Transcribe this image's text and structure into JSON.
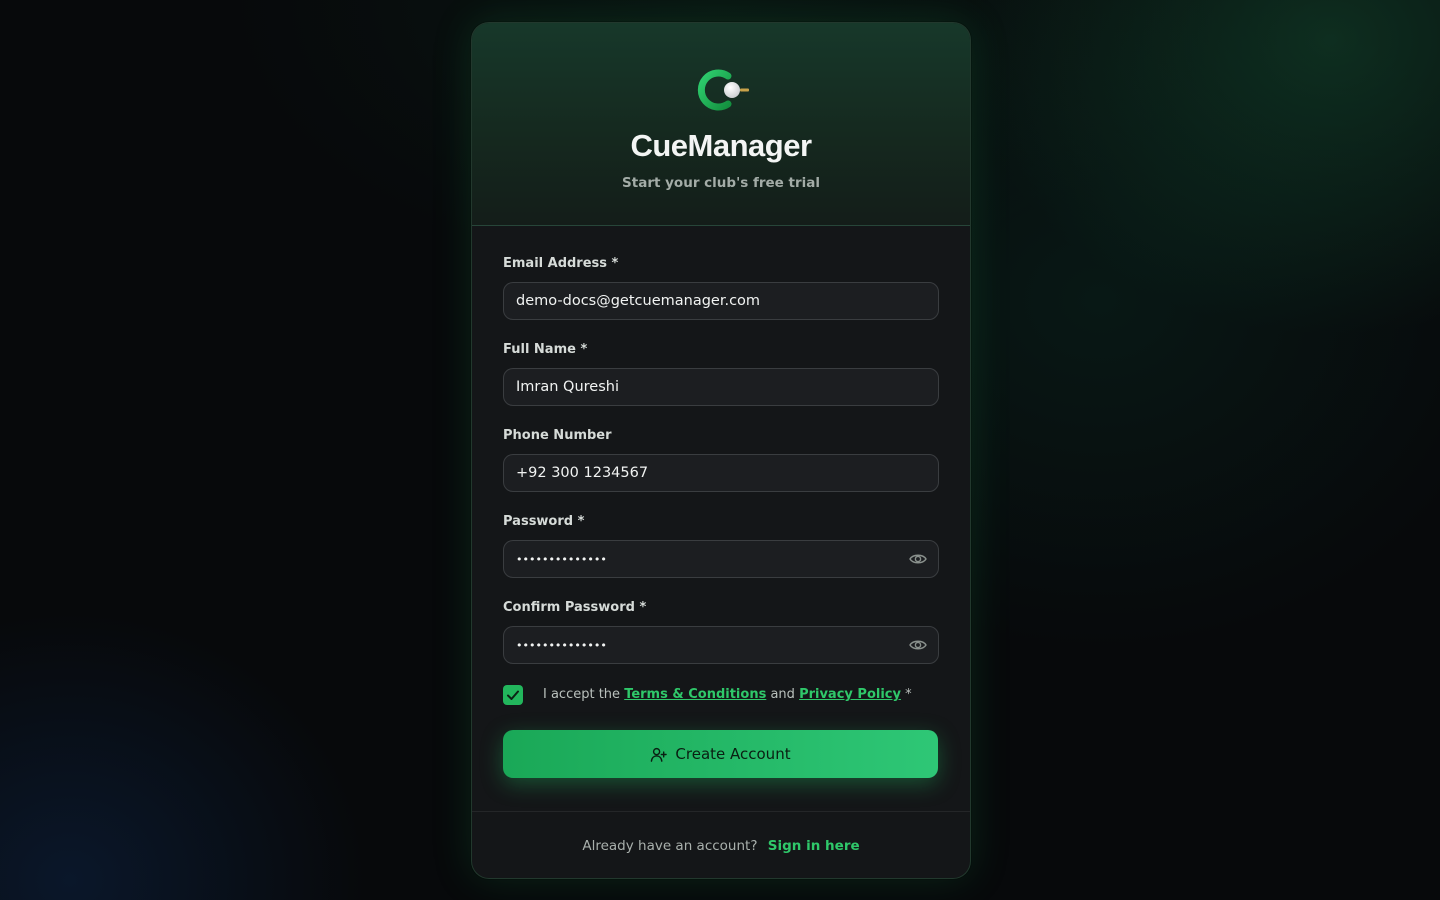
{
  "brand": {
    "name": "CueManager",
    "tagline": "Start your club's free trial",
    "logo_icon": "cue-ball-logo-icon",
    "accent_color": "#22b65c"
  },
  "form": {
    "email": {
      "label": "Email Address *",
      "value": "demo-docs@getcuemanager.com"
    },
    "full_name": {
      "label": "Full Name *",
      "value": "Imran Qureshi"
    },
    "phone": {
      "label": "Phone Number",
      "value": "+92 300 1234567"
    },
    "password": {
      "label": "Password *",
      "value": "••••••••••••••",
      "toggle_icon": "eye-icon"
    },
    "confirm_password": {
      "label": "Confirm Password *",
      "value": "••••••••••••••",
      "toggle_icon": "eye-icon"
    },
    "terms": {
      "checked": true,
      "prefix": "I accept the",
      "terms_link": "Terms & Conditions",
      "and": "and",
      "privacy_link": "Privacy Policy",
      "suffix": "*"
    },
    "submit": {
      "label": "Create Account",
      "icon": "user-plus-icon"
    }
  },
  "footer": {
    "text": "Already have an account?",
    "link": "Sign in here"
  }
}
